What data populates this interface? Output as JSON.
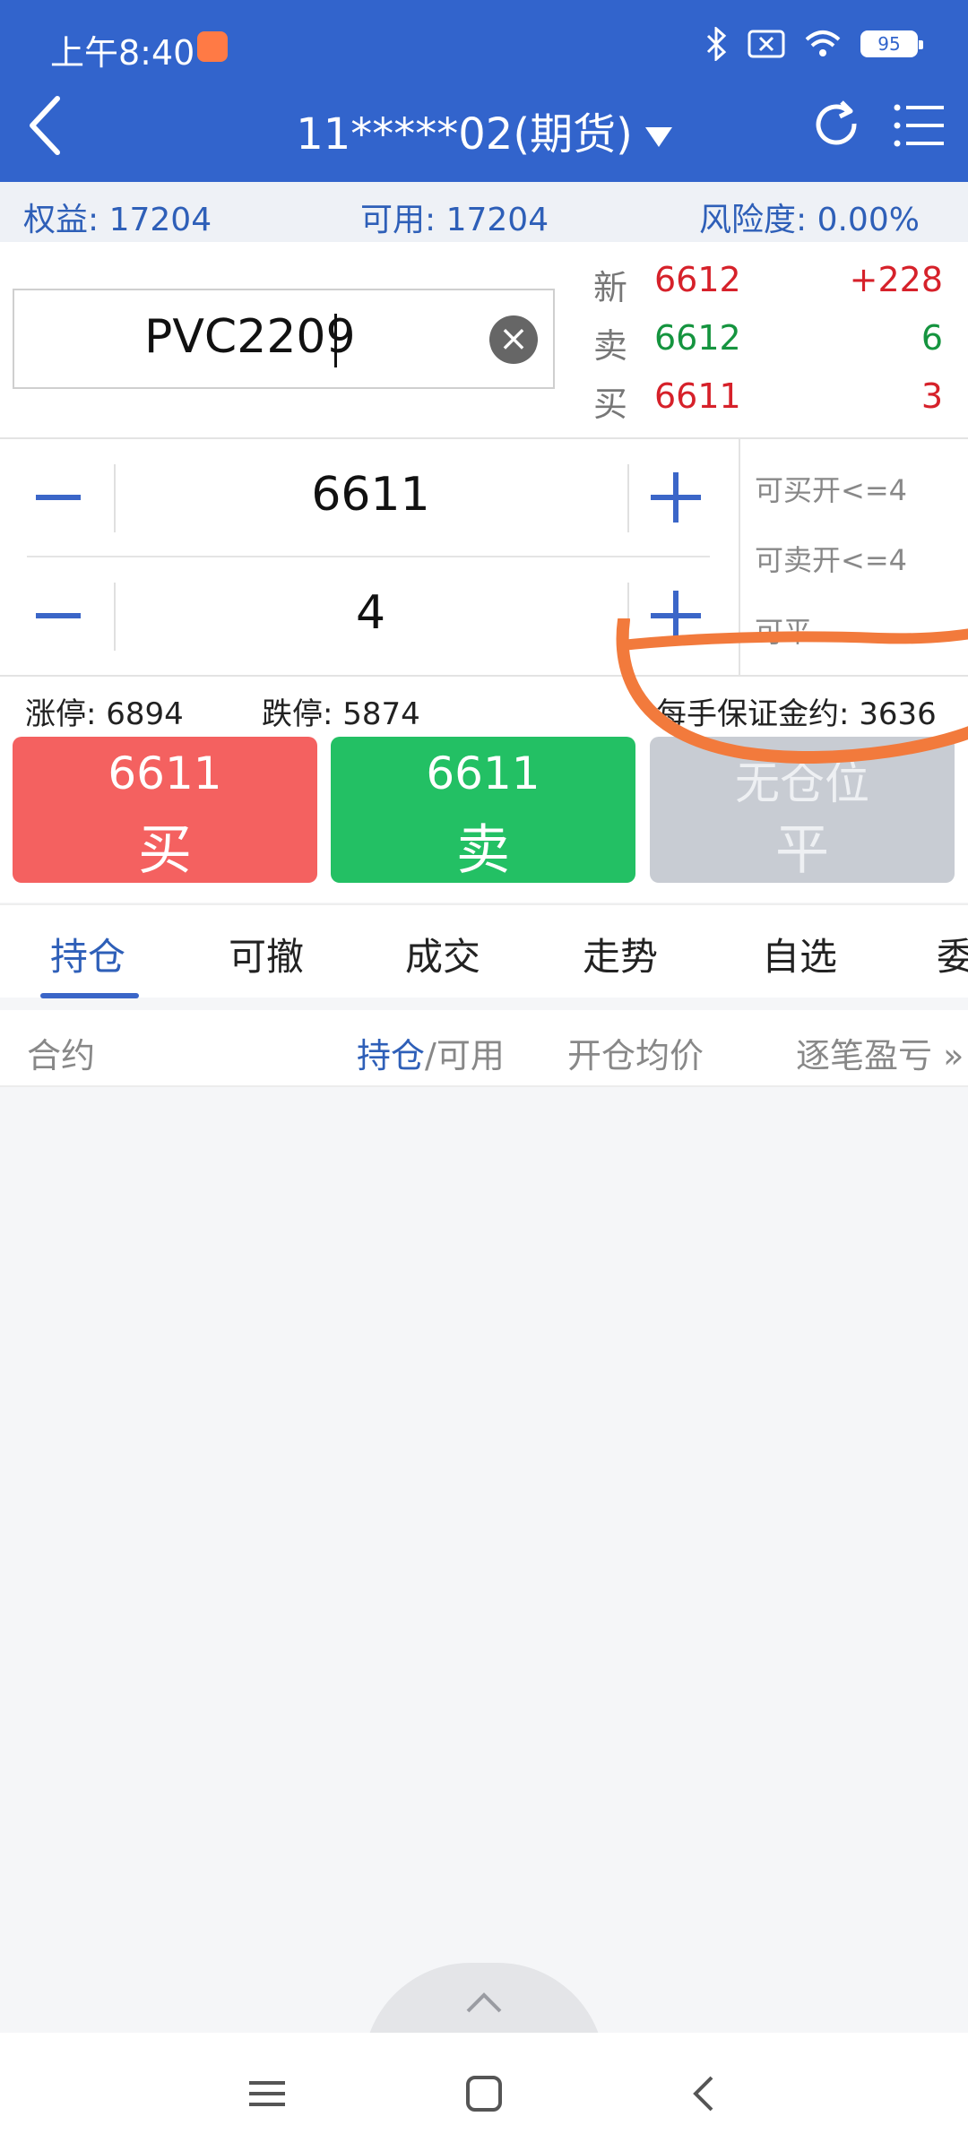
{
  "status_bar": {
    "time": "上午8:40",
    "battery": "95",
    "icons": [
      "app-notification-icon",
      "bluetooth-icon",
      "no-sim-icon",
      "wifi-icon",
      "battery-icon"
    ]
  },
  "header": {
    "title": "11*****02(期货)",
    "icons": [
      "back-arrow-icon",
      "dropdown-caret-icon",
      "refresh-icon",
      "menu-list-icon"
    ]
  },
  "account": {
    "equity": "权益: 17204",
    "available": "可用: 17204",
    "risk": "风险度:   0.00%"
  },
  "quote": {
    "symbol": "PVC2209",
    "rows": [
      {
        "label": "新",
        "price": "6612",
        "change": "+228"
      },
      {
        "label": "卖",
        "price": "6612",
        "change": "6"
      },
      {
        "label": "买",
        "price": "6611",
        "change": "3"
      }
    ]
  },
  "order": {
    "price": "6611",
    "quantity": "4",
    "can_buy_open": "可买开<=4",
    "can_sell_open": "可卖开<=4",
    "can_close": "可平 ----"
  },
  "limits": {
    "limit_up": "涨停: 6894",
    "limit_down": "跌停: 5874",
    "margin_per_lot": "每手保证金约: 3636"
  },
  "actions": {
    "buy_price": "6611",
    "buy_label": "买",
    "sell_price": "6611",
    "sell_label": "卖",
    "close_top": "无仓位",
    "close_label": "平"
  },
  "tabs": [
    "持仓",
    "可撤",
    "成交",
    "走势",
    "自选",
    "委"
  ],
  "list_header": {
    "contract": "合约",
    "position": "持仓",
    "available": "/可用",
    "avg_open": "开仓均价",
    "pnl": "逐笔盈亏 »"
  },
  "colors": {
    "header_bg": "#3264cc",
    "accent": "#3b66c8",
    "up_red": "#d6212a",
    "down_green": "#15943f",
    "buy_button": "#f46160",
    "sell_button": "#23c064",
    "disabled_button": "#c8ccd3",
    "annotation_orange": "#f27a3c"
  }
}
